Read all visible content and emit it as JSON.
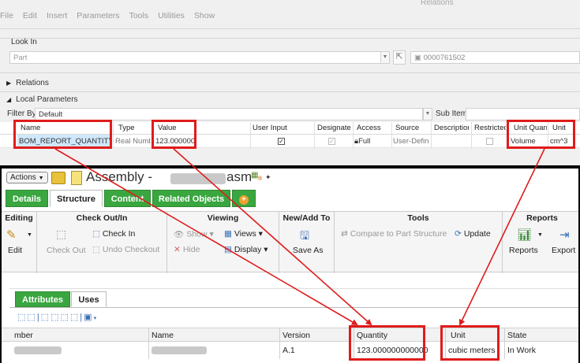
{
  "relations_window": {
    "title": "Relations",
    "menu": [
      "File",
      "Edit",
      "Insert",
      "Parameters",
      "Tools",
      "Utilities",
      "Show"
    ],
    "look_in_label": "Look In",
    "look_in_value": "Part",
    "part_number": "0000761502",
    "relations_section": "Relations",
    "local_params_section": "Local Parameters",
    "filter_by_label": "Filter By",
    "filter_value": "Default",
    "sub_items_label": "Sub Items",
    "columns": [
      "Name",
      "Type",
      "Value",
      "User Input",
      "Designate",
      "Access",
      "Source",
      "Description",
      "Restricted",
      "Unit Quantity",
      "Unit"
    ],
    "row": {
      "name": "BOM_REPORT_QUANTITY",
      "type": "Real Number",
      "value": "123.000000",
      "user_input": true,
      "designate": true,
      "access": "Full",
      "source": "User-Defined",
      "description": "",
      "restricted": false,
      "unit_quantity": "Volume",
      "unit": "cm^3"
    }
  },
  "windchill": {
    "actions_label": "Actions",
    "title_prefix": "Assembly -",
    "title_suffix": "asm",
    "tabs": [
      "Details",
      "Structure",
      "Content",
      "Related Objects"
    ],
    "selected_tab": "Structure",
    "ribbon": {
      "editing": {
        "title": "Editing",
        "edit": "Edit"
      },
      "checkout": {
        "title": "Check Out/In",
        "check_in": "Check In",
        "check_out": "Check Out",
        "undo_checkout": "Undo Checkout"
      },
      "viewing": {
        "title": "Viewing",
        "show": "Show",
        "views": "Views",
        "hide": "Hide",
        "display": "Display"
      },
      "new_add": {
        "title": "New/Add To",
        "save_as": "Save As"
      },
      "tools": {
        "title": "Tools",
        "compare": "Compare to Part Structure",
        "update": "Update"
      },
      "reports": {
        "title": "Reports",
        "reports": "Reports",
        "export": "Export"
      }
    },
    "subtabs": [
      "Attributes",
      "Uses"
    ],
    "selected_subtab": "Uses",
    "table": {
      "columns": [
        "mber",
        "Name",
        "Version",
        "Quantity",
        "Unit",
        "State"
      ],
      "row": {
        "number": "",
        "name": "",
        "version": "A.1",
        "quantity": "123.000000000000",
        "unit": "cubic meters",
        "state": "In Work"
      }
    }
  },
  "colors": {
    "highlight": "#e01b1b",
    "tab_green": "#3aa640",
    "selection_blue": "#cfe8fb"
  }
}
